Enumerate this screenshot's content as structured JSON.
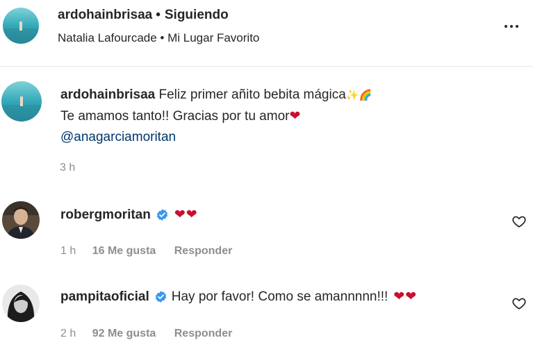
{
  "header": {
    "username": "ardohainbrisaa",
    "separator": "•",
    "follow_status": "Siguiendo",
    "audio": "Natalia Lafourcade • Mi Lugar Favorito"
  },
  "caption": {
    "username": "ardohainbrisaa",
    "line1": "Feliz primer añito bebita mágica",
    "line1_emoji": "✨🌈",
    "line2": "Te amamos tanto!! Gracias por tu amor",
    "line2_emoji": "❤",
    "mention": "@anagarciamoritan",
    "time": "3 h"
  },
  "comments": [
    {
      "username": "robergmoritan",
      "text": "",
      "emoji": "❤❤",
      "time": "1 h",
      "likes": "16 Me gusta",
      "reply": "Responder"
    },
    {
      "username": "pampitaoficial",
      "text": "Hay por favor! Como se amannnnn!!!",
      "emoji": "❤❤",
      "time": "2 h",
      "likes": "92 Me gusta",
      "reply": "Responder"
    }
  ],
  "icons": {
    "more": "more-horizontal-icon",
    "verified": "verified-badge-icon",
    "like": "heart-outline-icon"
  },
  "colors": {
    "verified": "#3897f0",
    "heart": "#c8102e",
    "mention": "#00376b",
    "secondary_text": "#8e8e8e"
  }
}
